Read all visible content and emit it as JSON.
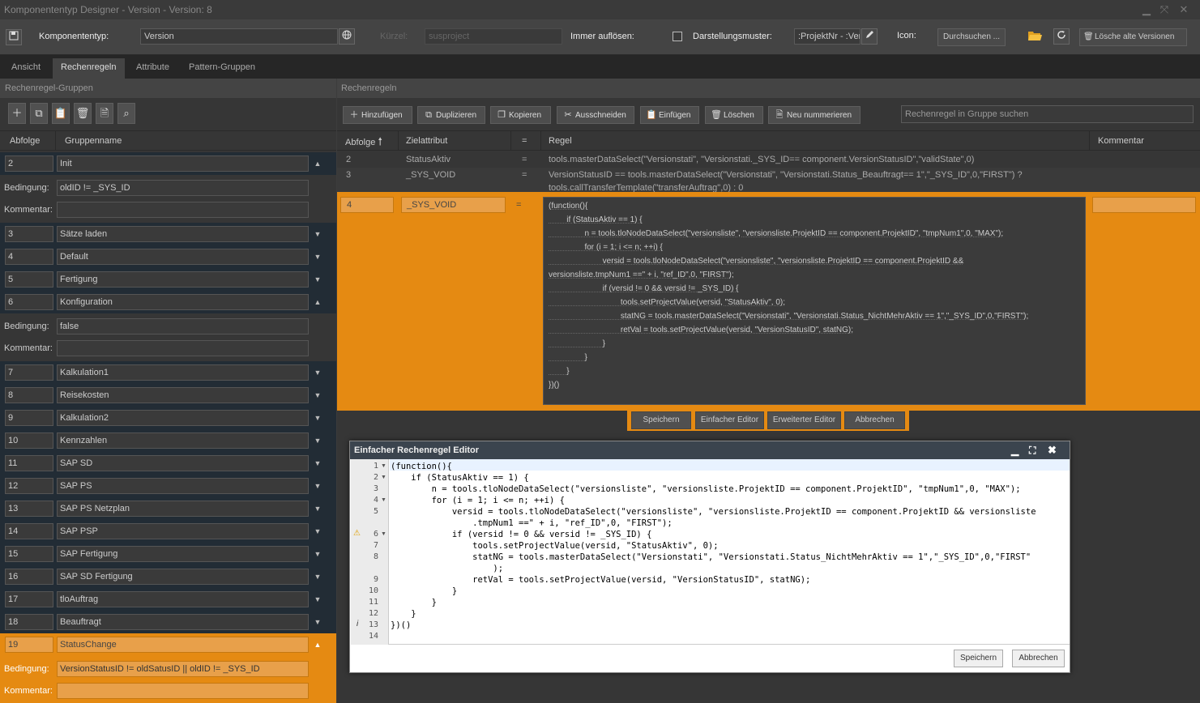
{
  "window": {
    "title": "Komponententyp Designer - Version - Version: 8",
    "minimize": "▁",
    "restore": "⤧",
    "close": "✕"
  },
  "toolbar": {
    "save_icon": "save-icon",
    "komponententyp_label": "Komponententyp:",
    "komponententyp_value": "Version",
    "kuerzel_label": "Kürzel:",
    "kuerzel_value": "susproject",
    "immer_aufloesen_label": "Immer auflösen:",
    "darstellungsmuster_label": "Darstellungsmuster:",
    "darstellungsmuster_value": ":ProjektNr - :Ver",
    "icon_label": "Icon:",
    "durchsuchen_label": "Durchsuchen ...",
    "loesche_label": "Lösche alte Versionen"
  },
  "tabs": [
    {
      "label": "Ansicht"
    },
    {
      "label": "Rechenregeln"
    },
    {
      "label": "Attribute"
    },
    {
      "label": "Pattern-Gruppen"
    }
  ],
  "left": {
    "section_title": "Rechenregel-Gruppen",
    "col_abfolge": "Abfolge",
    "col_gruppenname": "Gruppenname",
    "bedingung_label": "Bedingung:",
    "kommentar_label": "Kommentar:",
    "groups": [
      {
        "num": "2",
        "name": "Init"
      },
      {
        "num": "3",
        "name": "Sätze laden"
      },
      {
        "num": "4",
        "name": "Default"
      },
      {
        "num": "5",
        "name": "Fertigung"
      },
      {
        "num": "6",
        "name": "Konfiguration"
      },
      {
        "num": "7",
        "name": "Kalkulation1"
      },
      {
        "num": "8",
        "name": "Reisekosten"
      },
      {
        "num": "9",
        "name": "Kalkulation2"
      },
      {
        "num": "10",
        "name": "Kennzahlen"
      },
      {
        "num": "11",
        "name": "SAP SD"
      },
      {
        "num": "12",
        "name": "SAP PS"
      },
      {
        "num": "13",
        "name": "SAP PS Netzplan"
      },
      {
        "num": "14",
        "name": "SAP PSP"
      },
      {
        "num": "15",
        "name": "SAP Fertigung"
      },
      {
        "num": "16",
        "name": "SAP SD Fertigung"
      },
      {
        "num": "17",
        "name": "tloAuftrag"
      },
      {
        "num": "18",
        "name": "Beauftragt"
      },
      {
        "num": "19",
        "name": "StatusChange"
      }
    ],
    "init_condition": "oldID != _SYS_ID",
    "konfig_condition": "false",
    "status_condition": "VersionStatusID != oldSatusID || oldID != _SYS_ID"
  },
  "right": {
    "section_title": "Rechenregeln",
    "buttons": {
      "add": "Hinzufügen",
      "dup": "Duplizieren",
      "copy": "Kopieren",
      "cut": "Ausschneiden",
      "paste": "Einfügen",
      "del": "Löschen",
      "renum": "Neu nummerieren"
    },
    "search_placeholder": "Rechenregel in Gruppe suchen",
    "col_abfolge": "Abfolge",
    "col_ziel": "Zielattribut",
    "col_eq": "=",
    "col_regel": "Regel",
    "col_kommentar": "Kommentar",
    "rows": [
      {
        "num": "2",
        "ziel": "StatusAktiv",
        "eq": "=",
        "regel": "tools.masterDataSelect(\"Versionstati\", \"Versionstati._SYS_ID== component.VersionStatusID\",\"validState\",0)"
      },
      {
        "num": "3",
        "ziel": "_SYS_VOID",
        "eq": "=",
        "regel": "VersionStatusID == tools.masterDataSelect(\"Versionstati\", \"Versionstati.Status_Beauftragt== 1\",\"_SYS_ID\",0,\"FIRST\") ?",
        "regel2": "tools.callTransferTemplate(\"transferAuftrag\",0) : 0"
      },
      {
        "num": "4",
        "ziel": "_SYS_VOID",
        "eq": "="
      }
    ],
    "active_code": "(function(){\n        if (StatusAktiv == 1) {\n                n = tools.tloNodeDataSelect(\"versionsliste\", \"versionsliste.ProjektID == component.ProjektID\", \"tmpNum1\",0, \"MAX\");\n                for (i = 1; i <= n; ++i) {\n                        versid = tools.tloNodeDataSelect(\"versionsliste\", \"versionsliste.ProjektID == component.ProjektID &&\nversionsliste.tmpNum1 ==\" + i, \"ref_ID\",0, \"FIRST\");\n                        if (versid != 0 && versid != _SYS_ID) {\n                                tools.setProjectValue(versid, \"StatusAktiv\", 0);\n                                statNG = tools.masterDataSelect(\"Versionstati\", \"Versionstati.Status_NichtMehrAktiv == 1\",\"_SYS_ID\",0,\"FIRST\");\n                                retVal = tools.setProjectValue(versid, \"VersionStatusID\", statNG);\n                        }\n                }\n        }\n})()",
    "bottom": {
      "save": "Speichern",
      "simple": "Einfacher Editor",
      "extended": "Erweiterter Editor",
      "cancel": "Abbrechen"
    }
  },
  "dialog": {
    "title": "Einfacher Rechenregel Editor",
    "save": "Speichern",
    "cancel": "Abbrechen",
    "lines": [
      "(function(){",
      "    if (StatusAktiv == 1) {",
      "        n = tools.tloNodeDataSelect(\"versionsliste\", \"versionsliste.ProjektID == component.ProjektID\", \"tmpNum1\",0, \"MAX\");",
      "        for (i = 1; i <= n; ++i) {",
      "            versid = tools.tloNodeDataSelect(\"versionsliste\", \"versionsliste.ProjektID == component.ProjektID && versionsliste",
      "                .tmpNum1 ==\" + i, \"ref_ID\",0, \"FIRST\");",
      "            if (versid != 0 && versid != _SYS_ID) {",
      "                tools.setProjectValue(versid, \"StatusAktiv\", 0);",
      "                statNG = tools.masterDataSelect(\"Versionstati\", \"Versionstati.Status_NichtMehrAktiv == 1\",\"_SYS_ID\",0,\"FIRST\"",
      "                    );",
      "                retVal = tools.setProjectValue(versid, \"VersionStatusID\", statNG);",
      "            }",
      "        }",
      "    }",
      "})()",
      ""
    ],
    "line_numbers": [
      "1",
      "2",
      "3",
      "4",
      "5",
      "",
      "6",
      "7",
      "8",
      "",
      "9",
      "10",
      "11",
      "12",
      "13",
      "14"
    ]
  }
}
